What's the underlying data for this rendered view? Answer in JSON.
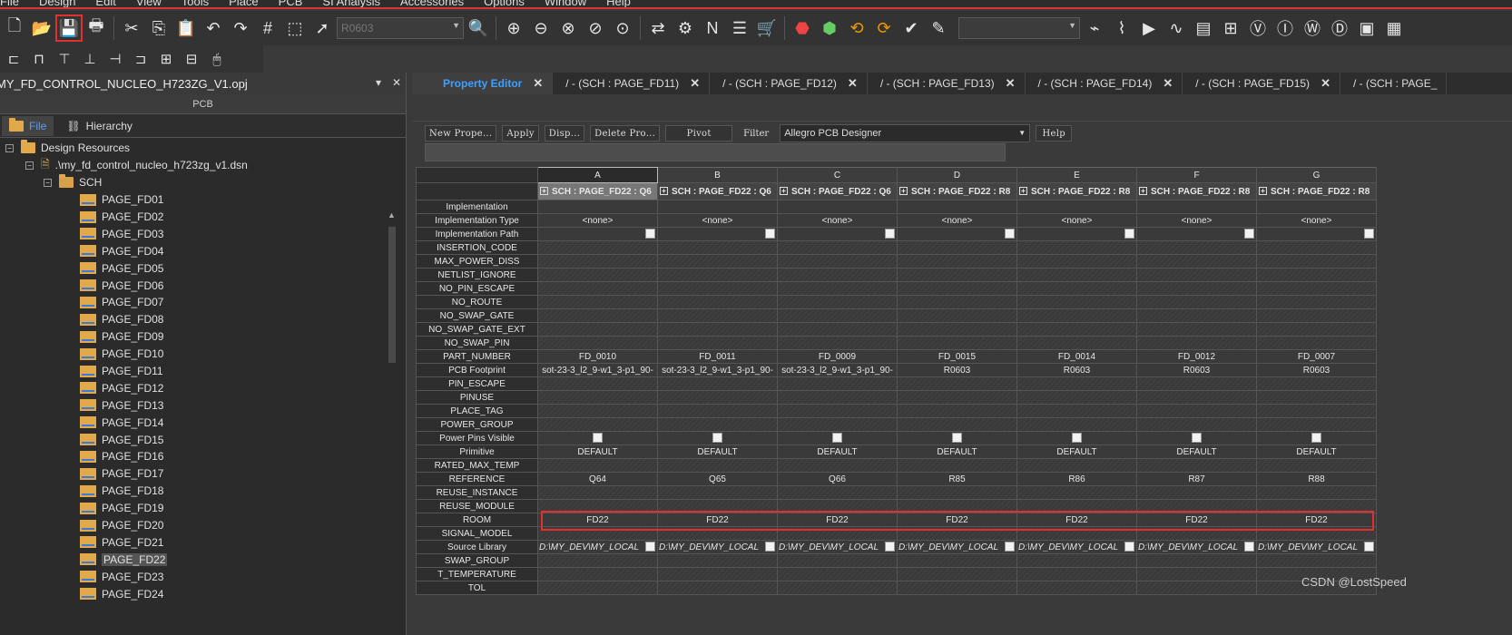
{
  "menu": [
    "File",
    "Design",
    "Edit",
    "View",
    "Tools",
    "Place",
    "PCB",
    "SI Analysis",
    "Accessories",
    "Options",
    "Window",
    "Help"
  ],
  "toolbar": {
    "part_combo": "R0603",
    "right_combo": ""
  },
  "project": {
    "file": "MY_FD_CONTROL_NUCLEO_H723ZG_V1.opj",
    "pcb_label": "PCB",
    "tabs": [
      "File",
      "Hierarchy"
    ],
    "root": "Design Resources",
    "dsn": ".\\my_fd_control_nucleo_h723zg_v1.dsn",
    "sch": "SCH",
    "pages": [
      "PAGE_FD01",
      "PAGE_FD02",
      "PAGE_FD03",
      "PAGE_FD04",
      "PAGE_FD05",
      "PAGE_FD06",
      "PAGE_FD07",
      "PAGE_FD08",
      "PAGE_FD09",
      "PAGE_FD10",
      "PAGE_FD11",
      "PAGE_FD12",
      "PAGE_FD13",
      "PAGE_FD14",
      "PAGE_FD15",
      "PAGE_FD16",
      "PAGE_FD17",
      "PAGE_FD18",
      "PAGE_FD19",
      "PAGE_FD20",
      "PAGE_FD21",
      "PAGE_FD22",
      "PAGE_FD23",
      "PAGE_FD24"
    ],
    "selected_page": "PAGE_FD22"
  },
  "doc_tabs": [
    "Property Editor",
    "/ - (SCH : PAGE_FD11)",
    "/ - (SCH : PAGE_FD12)",
    "/ - (SCH : PAGE_FD13)",
    "/ - (SCH : PAGE_FD14)",
    "/ - (SCH : PAGE_FD15)",
    "/ - (SCH : PAGE_"
  ],
  "editor": {
    "buttons": [
      "New Prope...",
      "Apply",
      "Disp...",
      "Delete Pro...",
      "Pivot"
    ],
    "filter_label": "Filter",
    "filter_value": "Allegro PCB Designer",
    "help_label": "Help"
  },
  "grid": {
    "columns": [
      "A",
      "B",
      "C",
      "D",
      "E",
      "F",
      "G"
    ],
    "parts": [
      "SCH : PAGE_FD22 : Q6",
      "SCH : PAGE_FD22 : Q6",
      "SCH : PAGE_FD22 : Q6",
      "SCH : PAGE_FD22 : R8",
      "SCH : PAGE_FD22 : R8",
      "SCH : PAGE_FD22 : R8",
      "SCH : PAGE_FD22 : R8"
    ],
    "rows": [
      {
        "name": "Implementation",
        "kind": "plain",
        "values": [
          "",
          "",
          "",
          "",
          "",
          "",
          ""
        ]
      },
      {
        "name": "Implementation Type",
        "kind": "plain",
        "values": [
          "<none>",
          "<none>",
          "<none>",
          "<none>",
          "<none>",
          "<none>",
          "<none>"
        ]
      },
      {
        "name": "Implementation Path",
        "kind": "ipath",
        "values": [
          "",
          "",
          "",
          "",
          "",
          "",
          ""
        ]
      },
      {
        "name": "INSERTION_CODE",
        "kind": "hatch",
        "values": [
          "",
          "",
          "",
          "",
          "",
          "",
          ""
        ]
      },
      {
        "name": "MAX_POWER_DISS",
        "kind": "hatch",
        "values": [
          "",
          "",
          "",
          "",
          "",
          "",
          ""
        ]
      },
      {
        "name": "NETLIST_IGNORE",
        "kind": "hatch",
        "values": [
          "",
          "",
          "",
          "",
          "",
          "",
          ""
        ]
      },
      {
        "name": "NO_PIN_ESCAPE",
        "kind": "hatch",
        "values": [
          "",
          "",
          "",
          "",
          "",
          "",
          ""
        ]
      },
      {
        "name": "NO_ROUTE",
        "kind": "hatch",
        "values": [
          "",
          "",
          "",
          "",
          "",
          "",
          ""
        ]
      },
      {
        "name": "NO_SWAP_GATE",
        "kind": "hatch",
        "values": [
          "",
          "",
          "",
          "",
          "",
          "",
          ""
        ]
      },
      {
        "name": "NO_SWAP_GATE_EXT",
        "kind": "hatch",
        "values": [
          "",
          "",
          "",
          "",
          "",
          "",
          ""
        ]
      },
      {
        "name": "NO_SWAP_PIN",
        "kind": "hatch",
        "values": [
          "",
          "",
          "",
          "",
          "",
          "",
          ""
        ]
      },
      {
        "name": "PART_NUMBER",
        "kind": "plain",
        "values": [
          "FD_0010",
          "FD_0011",
          "FD_0009",
          "FD_0015",
          "FD_0014",
          "FD_0012",
          "FD_0007"
        ]
      },
      {
        "name": "PCB Footprint",
        "kind": "plain",
        "values": [
          "sot-23-3_l2_9-w1_3-p1_90-",
          "sot-23-3_l2_9-w1_3-p1_90-",
          "sot-23-3_l2_9-w1_3-p1_90-",
          "R0603",
          "R0603",
          "R0603",
          "R0603"
        ]
      },
      {
        "name": "PIN_ESCAPE",
        "kind": "hatch",
        "values": [
          "",
          "",
          "",
          "",
          "",
          "",
          ""
        ]
      },
      {
        "name": "PINUSE",
        "kind": "hatch",
        "values": [
          "",
          "",
          "",
          "",
          "",
          "",
          ""
        ]
      },
      {
        "name": "PLACE_TAG",
        "kind": "hatch",
        "values": [
          "",
          "",
          "",
          "",
          "",
          "",
          ""
        ]
      },
      {
        "name": "POWER_GROUP",
        "kind": "hatch",
        "values": [
          "",
          "",
          "",
          "",
          "",
          "",
          ""
        ]
      },
      {
        "name": "Power Pins Visible",
        "kind": "check",
        "values": [
          "",
          "",
          "",
          "",
          "",
          "",
          ""
        ]
      },
      {
        "name": "Primitive",
        "kind": "plain",
        "values": [
          "DEFAULT",
          "DEFAULT",
          "DEFAULT",
          "DEFAULT",
          "DEFAULT",
          "DEFAULT",
          "DEFAULT"
        ]
      },
      {
        "name": "RATED_MAX_TEMP",
        "kind": "hatch",
        "values": [
          "",
          "",
          "",
          "",
          "",
          "",
          ""
        ]
      },
      {
        "name": "REFERENCE",
        "kind": "plain",
        "values": [
          "Q64",
          "Q65",
          "Q66",
          "R85",
          "R86",
          "R87",
          "R88"
        ]
      },
      {
        "name": "REUSE_INSTANCE",
        "kind": "hatch",
        "values": [
          "",
          "",
          "",
          "",
          "",
          "",
          ""
        ]
      },
      {
        "name": "REUSE_MODULE",
        "kind": "hatch",
        "values": [
          "",
          "",
          "",
          "",
          "",
          "",
          ""
        ]
      },
      {
        "name": "ROOM",
        "kind": "plain",
        "values": [
          "FD22",
          "FD22",
          "FD22",
          "FD22",
          "FD22",
          "FD22",
          "FD22"
        ]
      },
      {
        "name": "SIGNAL_MODEL",
        "kind": "hatch",
        "values": [
          "",
          "",
          "",
          "",
          "",
          "",
          ""
        ]
      },
      {
        "name": "Source Library",
        "kind": "slib",
        "values": [
          "D:\\MY_DEV\\MY_LOCAL",
          "D:\\MY_DEV\\MY_LOCAL",
          "D:\\MY_DEV\\MY_LOCAL",
          "D:\\MY_DEV\\MY_LOCAL",
          "D:\\MY_DEV\\MY_LOCAL",
          "D:\\MY_DEV\\MY_LOCAL",
          "D:\\MY_DEV\\MY_LOCAL"
        ]
      },
      {
        "name": "SWAP_GROUP",
        "kind": "hatch",
        "values": [
          "",
          "",
          "",
          "",
          "",
          "",
          ""
        ]
      },
      {
        "name": "T_TEMPERATURE",
        "kind": "hatch",
        "values": [
          "",
          "",
          "",
          "",
          "",
          "",
          ""
        ]
      },
      {
        "name": "TOL",
        "kind": "hatch",
        "values": [
          "",
          "",
          "",
          "",
          "",
          "",
          ""
        ]
      }
    ]
  },
  "watermark": "CSDN @LostSpeed",
  "colors": {
    "accent": "#3ea0ff",
    "highlight": "#e03030",
    "folder": "#e2a94a"
  }
}
